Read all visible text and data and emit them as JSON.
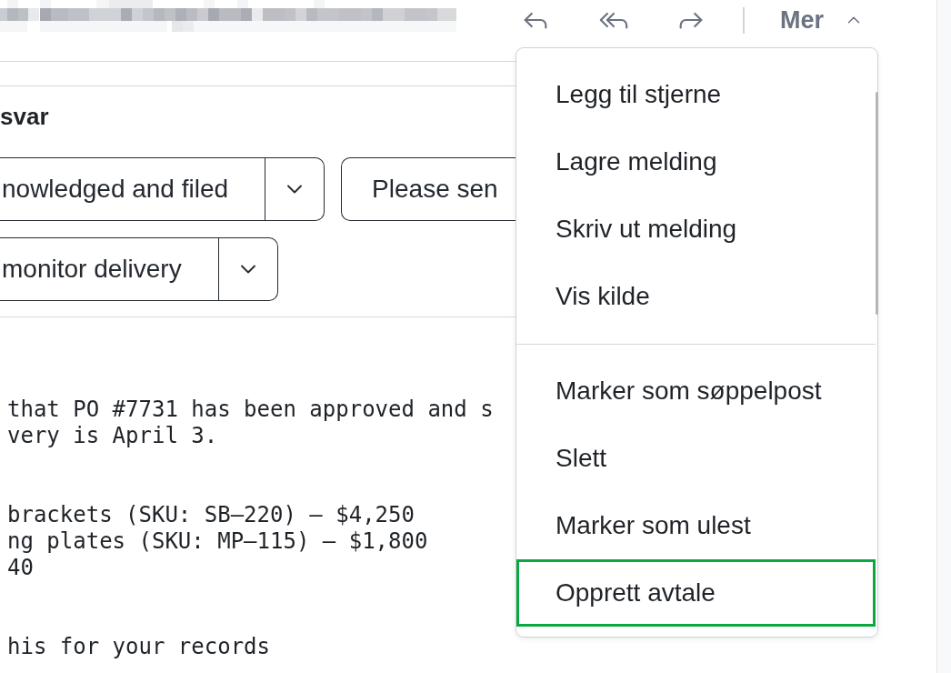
{
  "toolbar": {
    "more_button": {
      "label": "Mer",
      "expanded": true
    }
  },
  "suggested_replies": {
    "heading": "svar",
    "rows": [
      [
        {
          "kind": "split",
          "label": "nowledged and filed"
        },
        {
          "kind": "plain",
          "label": "Please sen"
        }
      ],
      [
        {
          "kind": "split",
          "label": "monitor delivery"
        }
      ]
    ]
  },
  "message_body": {
    "paragraphs": [
      [
        "that PO #7731 has been approved and s",
        "very is April 3."
      ],
      [
        "brackets (SKU: SB–220) – $4,250",
        "ng plates (SKU: MP–115) – $1,800",
        "40"
      ],
      [
        "his for your records"
      ]
    ]
  },
  "more_menu": {
    "groups": [
      {
        "items": [
          {
            "label": "Legg til stjerne",
            "selected": false
          },
          {
            "label": "Lagre melding",
            "selected": false
          },
          {
            "label": "Skriv ut melding",
            "selected": false
          },
          {
            "label": "Vis kilde",
            "selected": false
          }
        ]
      },
      {
        "items": [
          {
            "label": "Marker som søppelpost",
            "selected": false
          },
          {
            "label": "Slett",
            "selected": false
          },
          {
            "label": "Marker som ulest",
            "selected": false
          },
          {
            "label": "Opprett avtale",
            "selected": true
          }
        ]
      }
    ]
  }
}
